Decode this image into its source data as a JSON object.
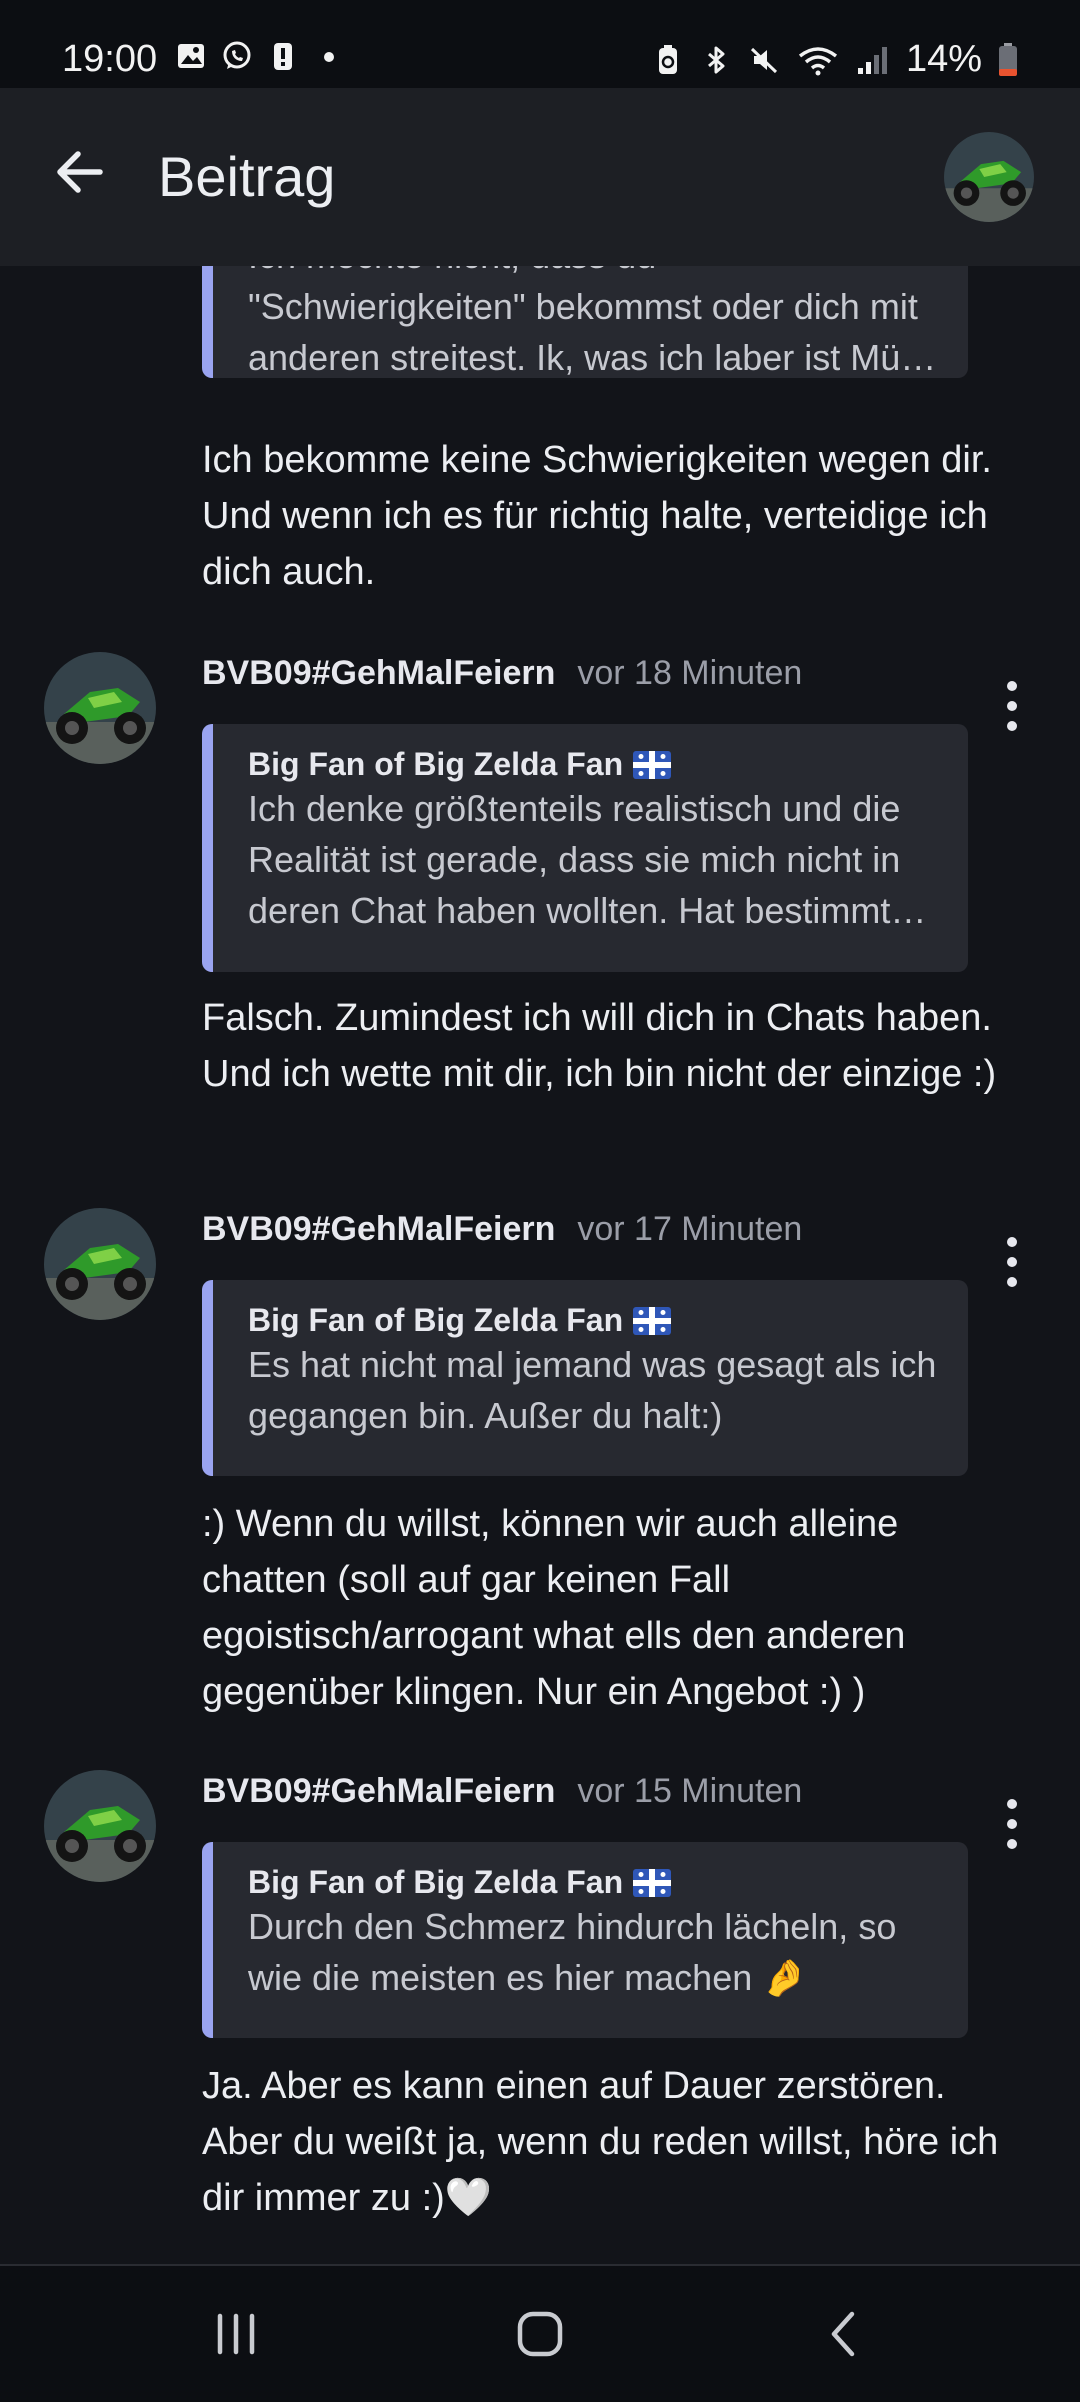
{
  "status_bar": {
    "time": "19:00",
    "left_icons": [
      "image-icon",
      "whatsapp-icon",
      "alert-icon",
      "dot-icon"
    ],
    "right_icons": [
      "battery-saver-icon",
      "bluetooth-icon",
      "mute-icon",
      "wifi-icon",
      "signal-icon"
    ],
    "battery": "14%"
  },
  "app_bar": {
    "title": "Beitrag",
    "back_icon": "arrow-left-icon"
  },
  "colors": {
    "background": "#121419",
    "quote_accent": "#9aa4f0",
    "quote_background": "#272930"
  },
  "posts": [
    {
      "quote": {
        "text": "Ich möchte nicht, dass du \"Schwierigkeiten\" bekommst oder dich mit anderen streitest. Ik, was ich laber ist Mü…"
      },
      "reply": "Ich bekomme keine Schwierigkeiten wegen dir. Und wenn ich es für richtig halte, verteidige ich dich auch."
    },
    {
      "author": "BVB09#GehMalFeiern",
      "time": "vor 18 Minuten",
      "quote": {
        "author": "Big Fan of Big Zelda Fan",
        "text": "Ich denke größtenteils realistisch und die Realität ist gerade, dass sie mich nicht in deren Chat haben wollten. Hat bestimmt…"
      },
      "reply": "Falsch. Zumindest ich will dich in Chats haben. Und ich wette mit dir, ich bin nicht der einzige :)"
    },
    {
      "author": "BVB09#GehMalFeiern",
      "time": "vor 17 Minuten",
      "quote": {
        "author": "Big Fan of Big Zelda Fan",
        "text": "Es hat nicht mal jemand was gesagt als ich gegangen bin. Außer du halt:)"
      },
      "reply": ":) Wenn du willst, können wir auch alleine chatten (soll auf gar keinen Fall egoistisch/arrogant what ells den anderen gegenüber klingen. Nur ein Angebot :) )"
    },
    {
      "author": "BVB09#GehMalFeiern",
      "time": "vor 15 Minuten",
      "quote": {
        "author": "Big Fan of Big Zelda Fan",
        "text": "Durch den Schmerz hindurch lächeln, so wie die meisten es hier machen 🤌"
      },
      "reply": "Ja. Aber es kann einen auf Dauer zerstören. Aber du weißt ja, wenn du reden willst, höre ich dir immer zu :)🤍"
    }
  ],
  "nav_bar": {
    "icons": [
      "recent-apps-icon",
      "home-icon",
      "back-icon"
    ]
  }
}
